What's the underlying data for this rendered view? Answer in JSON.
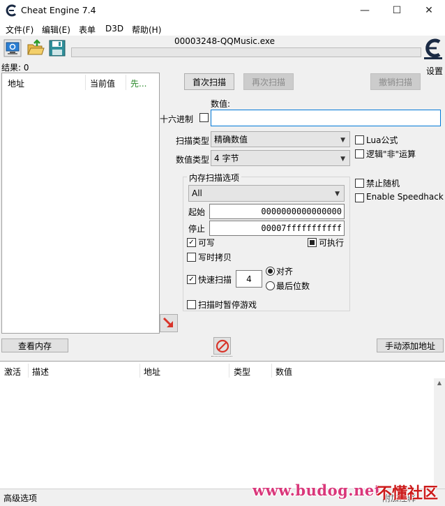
{
  "window": {
    "title": "Cheat Engine 7.4",
    "minimize_glyph": "—",
    "maximize_glyph": "☐",
    "close_glyph": "✕"
  },
  "menu": [
    "文件(F)",
    "编辑(E)",
    "表单",
    "D3D",
    "帮助(H)"
  ],
  "toolbar": {
    "process_title": "00003248-QQMusic.exe",
    "settings_label": "设置",
    "icons": [
      "open-process-icon",
      "open-file-icon",
      "save-icon"
    ]
  },
  "results": {
    "label": "结果: 0",
    "columns": [
      "地址",
      "当前值",
      "先..."
    ]
  },
  "scan": {
    "first_scan": "首次扫描",
    "next_scan": "再次扫描",
    "undo_scan": "撤销扫描",
    "value_label": "数值:",
    "hex_label": "十六进制",
    "value_input": "",
    "scan_type_label": "扫描类型",
    "scan_type_value": "精确数值",
    "value_type_label": "数值类型",
    "value_type_value": "4 字节",
    "lua_label": "Lua公式",
    "not_label": "逻辑\"非\"运算",
    "no_random_label": "禁止随机",
    "speedhack_label": "Enable Speedhack"
  },
  "memory": {
    "group_title": "内存扫描选项",
    "region_value": "All",
    "start_label": "起始",
    "start_value": "0000000000000000",
    "stop_label": "停止",
    "stop_value": "00007fffffffffff",
    "writable_label": "可写",
    "writable_checked": true,
    "executable_label": "可执行",
    "executable_state": "indeterminate",
    "copy_on_write_label": "写时拷贝",
    "copy_on_write_checked": false,
    "fast_scan_label": "快速扫描",
    "fast_scan_checked": true,
    "fast_scan_value": "4",
    "align_label": "对齐",
    "last_digits_label": "最后位数",
    "align_selected": true,
    "pause_label": "扫描时暂停游戏",
    "pause_checked": false
  },
  "buttons": {
    "view_memory": "查看内存",
    "add_address": "手动添加地址"
  },
  "table": {
    "columns": [
      "激活",
      "描述",
      "地址",
      "类型",
      "数值"
    ]
  },
  "status": {
    "advanced": "高级选项",
    "right": "附加注释"
  },
  "watermark": {
    "url": "www.budog.net",
    "cn": "不懂社区"
  },
  "colors": {
    "accent_focus": "#0078d7",
    "disabled_text": "#8a8a8a",
    "watermark_pink": "#d9377a",
    "watermark_red": "#cc1b1b"
  }
}
